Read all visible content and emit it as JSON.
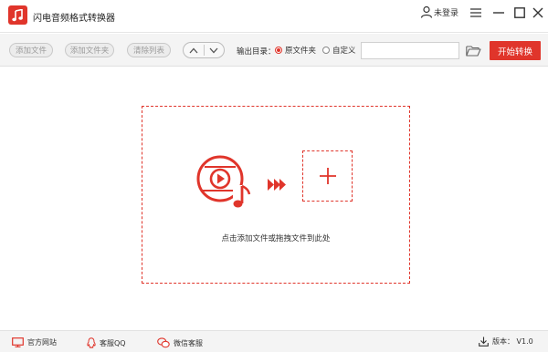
{
  "window": {
    "title": "闪电音频格式转换器",
    "user_label": "未登录"
  },
  "toolbar": {
    "add_file": "添加文件",
    "add_folder": "添加文件夹",
    "clear_list": "清除列表",
    "output_label": "输出目录：",
    "radio_original": "原文件夹",
    "radio_custom": "自定义",
    "selected_radio": "原文件夹",
    "path_value": "",
    "path_placeholder": "",
    "start_button": "开始转换"
  },
  "main": {
    "hint": "点击添加文件或拖拽文件到此处"
  },
  "footer": {
    "website": "官方网站",
    "qq": "客服QQ",
    "wechat": "微信客服",
    "version": "版本： V1.0"
  },
  "colors": {
    "accent": "#e0352b",
    "toolbar_bg": "#f4f4f4",
    "button_text_disabled": "#9b9b9b"
  },
  "icons": {
    "app": "music-note-icon",
    "user": "user-icon",
    "menu": "menu-icon",
    "minimize": "minimize-icon",
    "maximize": "maximize-icon",
    "close": "close-icon",
    "move_up": "chevron-up-icon",
    "move_down": "chevron-down-icon",
    "folder": "folder-icon",
    "drop": "music-video-icon",
    "forward": "double-chevron-right-icon",
    "add": "plus-icon",
    "website": "monitor-icon",
    "qq": "qq-icon",
    "wechat": "chat-icon",
    "version": "download-icon"
  }
}
